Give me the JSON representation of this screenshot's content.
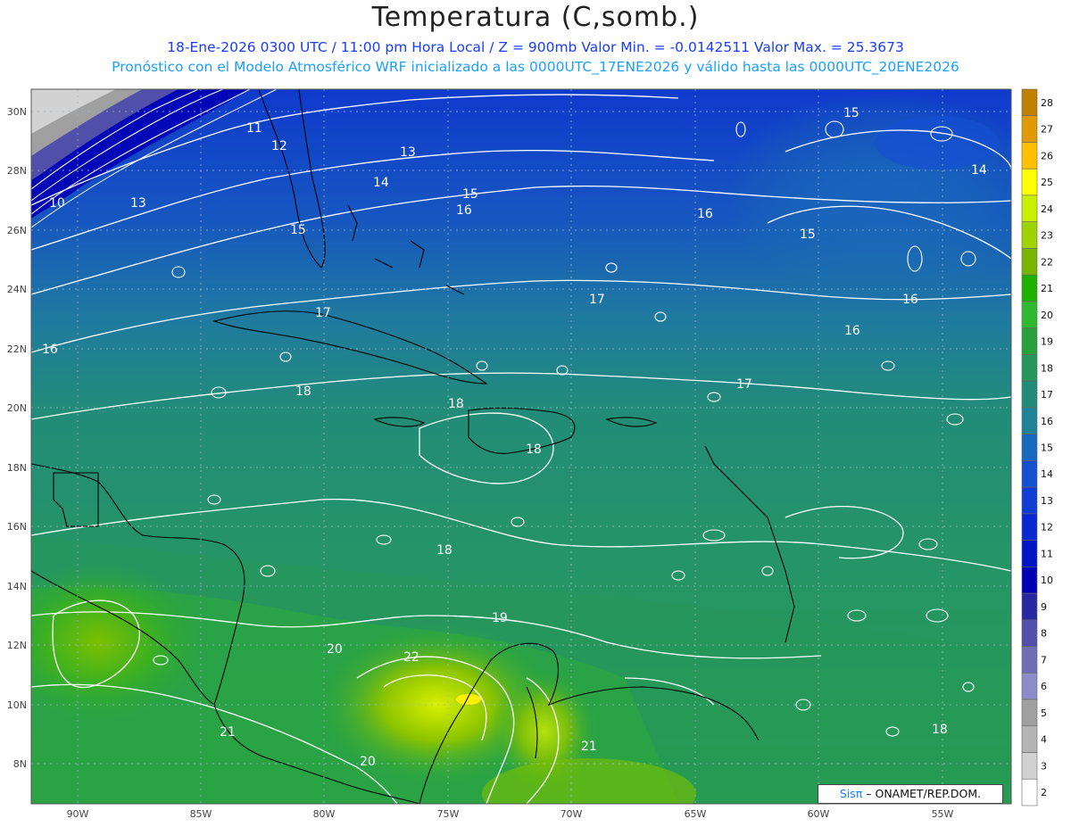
{
  "title": "Temperatura (C,somb.)",
  "subtitle_1": "18-Ene-2026  0300 UTC / 11:00 pm Hora Local / Z = 900mb Valor Min. = -0.0142511  Valor Max. = 25.3673",
  "subtitle_2": "Pronóstico con el Modelo Atmosférico WRF inicializado a las 0000UTC_17ENE2026 y válido hasta las  0000UTC_20ENE2026",
  "credit": {
    "sis": "Sisπ",
    "rest": " – ONAMET/REP.DOM."
  },
  "map": {
    "lon_labels": [
      "90W",
      "85W",
      "80W",
      "75W",
      "70W",
      "65W",
      "60W",
      "55W"
    ],
    "lat_labels": [
      "30N",
      "28N",
      "26N",
      "24N",
      "22N",
      "20N",
      "18N",
      "16N",
      "14N",
      "12N",
      "10N",
      "8N"
    ],
    "contour_labels": [
      "11",
      "12",
      "13",
      "10",
      "13",
      "14",
      "15",
      "15",
      "16",
      "16",
      "15",
      "14",
      "15",
      "16",
      "17",
      "16",
      "16",
      "17",
      "18",
      "18",
      "18",
      "17",
      "18",
      "19",
      "20",
      "22",
      "21",
      "21",
      "20",
      "18"
    ]
  },
  "colorbar": {
    "values": [
      "28",
      "27",
      "26",
      "25",
      "24",
      "23",
      "22",
      "21",
      "20",
      "19",
      "18",
      "17",
      "16",
      "15",
      "14",
      "13",
      "12",
      "11",
      "10",
      "9",
      "8",
      "7",
      "6",
      "5",
      "4",
      "3",
      "2"
    ],
    "colors": [
      "#c08000",
      "#e09b00",
      "#ffc000",
      "#ffff00",
      "#c8f000",
      "#a0d200",
      "#78b400",
      "#20b000",
      "#30b830",
      "#28a03c",
      "#26965a",
      "#228c78",
      "#1f8296",
      "#1868c0",
      "#1450d2",
      "#0f3cd2",
      "#0a28d2",
      "#0014c8",
      "#0000b4",
      "#2828a0",
      "#5050aa",
      "#6e6eb4",
      "#8c8cc8",
      "#a0a0a0",
      "#b4b4b4",
      "#d2d2d2",
      "#ffffff"
    ]
  }
}
